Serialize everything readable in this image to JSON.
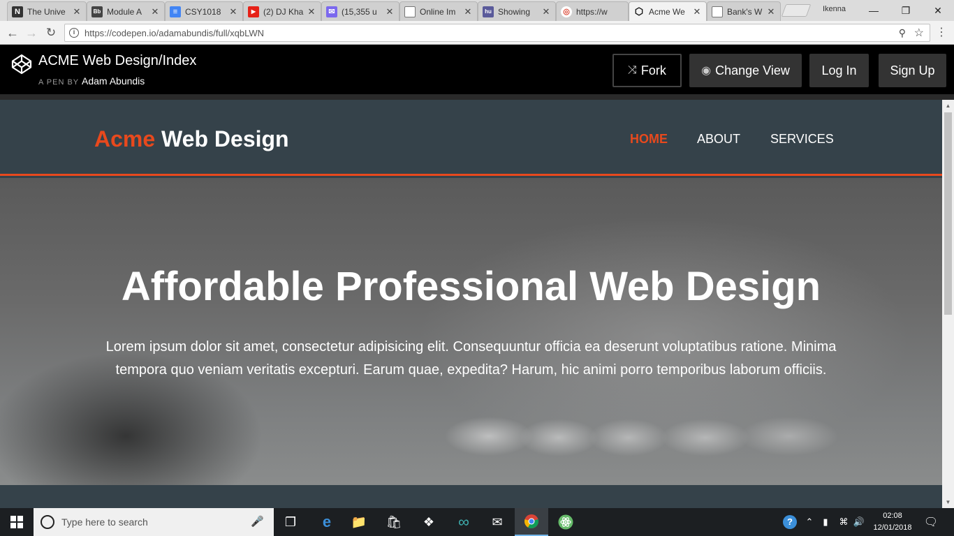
{
  "browser": {
    "tabs": [
      {
        "title": "The Unive",
        "favicon": "N",
        "color": "#333333"
      },
      {
        "title": "Module A",
        "favicon": "Bb",
        "color": "#444444"
      },
      {
        "title": "CSY1018",
        "favicon": "≡",
        "color": "#4285f4"
      },
      {
        "title": "(2) DJ Kha",
        "favicon": "▶",
        "color": "#e62117"
      },
      {
        "title": "(15,355 u",
        "favicon": "✉",
        "color": "#7b68ee"
      },
      {
        "title": "Online Im",
        "favicon": "",
        "color": ""
      },
      {
        "title": "Showing",
        "favicon": "hu",
        "color": "#5a5a9a"
      },
      {
        "title": "https://w",
        "favicon": "◎",
        "color": "#dd4b39"
      },
      {
        "title": "Acme We",
        "favicon": "⬡",
        "color": "#111111"
      },
      {
        "title": "Bank's W",
        "favicon": "",
        "color": ""
      }
    ],
    "profile_name": "Ikenna",
    "url": "https://codepen.io/adamabundis/full/xqbLWN",
    "tab_close_glyph": "✕"
  },
  "codepen": {
    "title": "ACME Web Design/Index",
    "byline_prefix": "A PEN BY",
    "author": "Adam Abundis",
    "buttons": {
      "fork": "Fork",
      "change_view": "Change View",
      "log_in": "Log In",
      "sign_up": "Sign Up"
    }
  },
  "site": {
    "brand_highlight": "Acme",
    "brand_rest": " Web Design",
    "nav": [
      "HOME",
      "ABOUT",
      "SERVICES"
    ],
    "hero_title": "Affordable Professional Web Design",
    "hero_text": "Lorem ipsum dolor sit amet, consectetur adipisicing elit. Consequuntur officia ea deserunt voluptatibus ratione. Minima tempora quo veniam veritatis excepturi. Earum quae, expedita? Harum, hic animi porro temporibus laborum officiis.",
    "accent_color": "#e8491d",
    "header_color": "#35424a"
  },
  "taskbar": {
    "search_placeholder": "Type here to search",
    "time": "02:08",
    "date": "12/01/2018"
  }
}
